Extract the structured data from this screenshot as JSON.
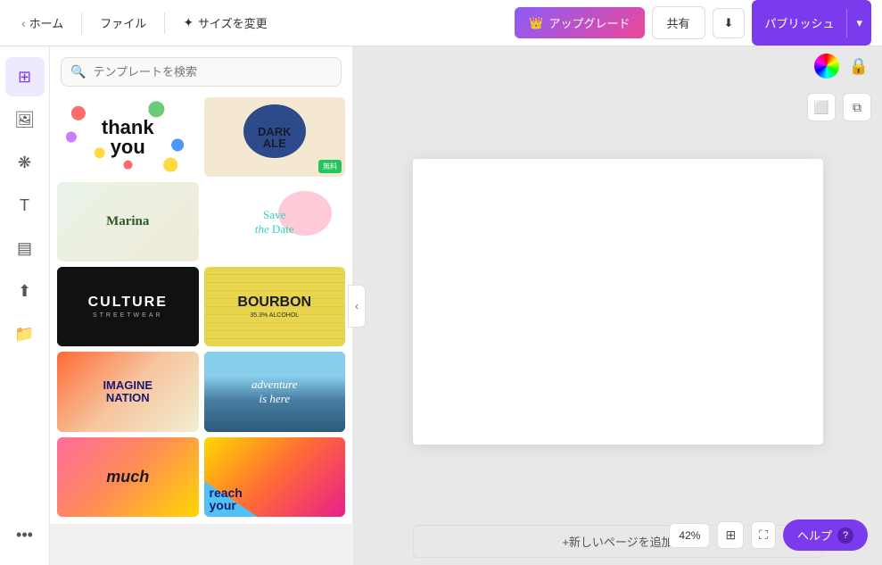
{
  "topbar": {
    "home_label": "ホーム",
    "file_label": "ファイル",
    "resize_label": "サイズを変更",
    "upgrade_label": "アップグレード",
    "share_label": "共有",
    "publish_label": "パブリッシュ"
  },
  "search": {
    "placeholder": "テンプレートを検索"
  },
  "templates": [
    {
      "id": "thank-you",
      "label": "thank you"
    },
    {
      "id": "dark-ale",
      "label": "DARK ALE",
      "badge": "無料"
    },
    {
      "id": "marina",
      "label": "Marina"
    },
    {
      "id": "save-the-date",
      "label": "Save the Date"
    },
    {
      "id": "culture",
      "label": "CULTURE",
      "sub": "STREETWEAR"
    },
    {
      "id": "bourbon",
      "label": "BOURBON"
    },
    {
      "id": "imagine-nation",
      "label": "IMAGINE NATION"
    },
    {
      "id": "adventure",
      "label": "adventure is here"
    },
    {
      "id": "much",
      "label": "much"
    },
    {
      "id": "reach",
      "label": "reach your"
    }
  ],
  "canvas": {
    "add_page_label": "+新しいページを追加"
  },
  "footer": {
    "zoom": "42%",
    "help_label": "ヘルプ",
    "help_icon": "?"
  }
}
